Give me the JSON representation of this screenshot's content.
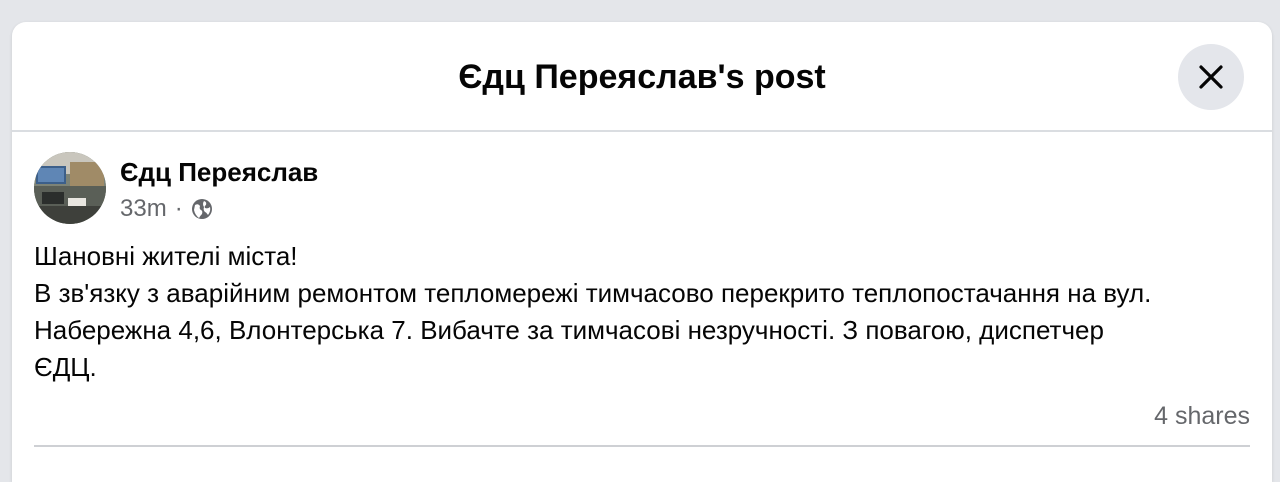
{
  "dialog": {
    "title": "Єдц Переяслав's post",
    "close_icon": "close-icon"
  },
  "post": {
    "author": "Єдц Переяслав",
    "time": "33m",
    "separator": "·",
    "audience_icon": "globe-icon",
    "text_lines": [
      "Шановні жителі міста!",
      "В зв'язку з аварійним ремонтом тепломережі тимчасово перекрито теплопостачання на вул.",
      "Набережна 4,6, Влонтерська 7. Вибачте за тимчасові незручності. З повагою, диспетчер",
      "ЄДЦ."
    ],
    "shares": "4 shares"
  },
  "colors": {
    "background": "#e4e6ea",
    "card": "#ffffff",
    "text_primary": "#050505",
    "text_secondary": "#65676b",
    "divider": "#dadde1",
    "close_button_bg": "#e4e6eb"
  }
}
